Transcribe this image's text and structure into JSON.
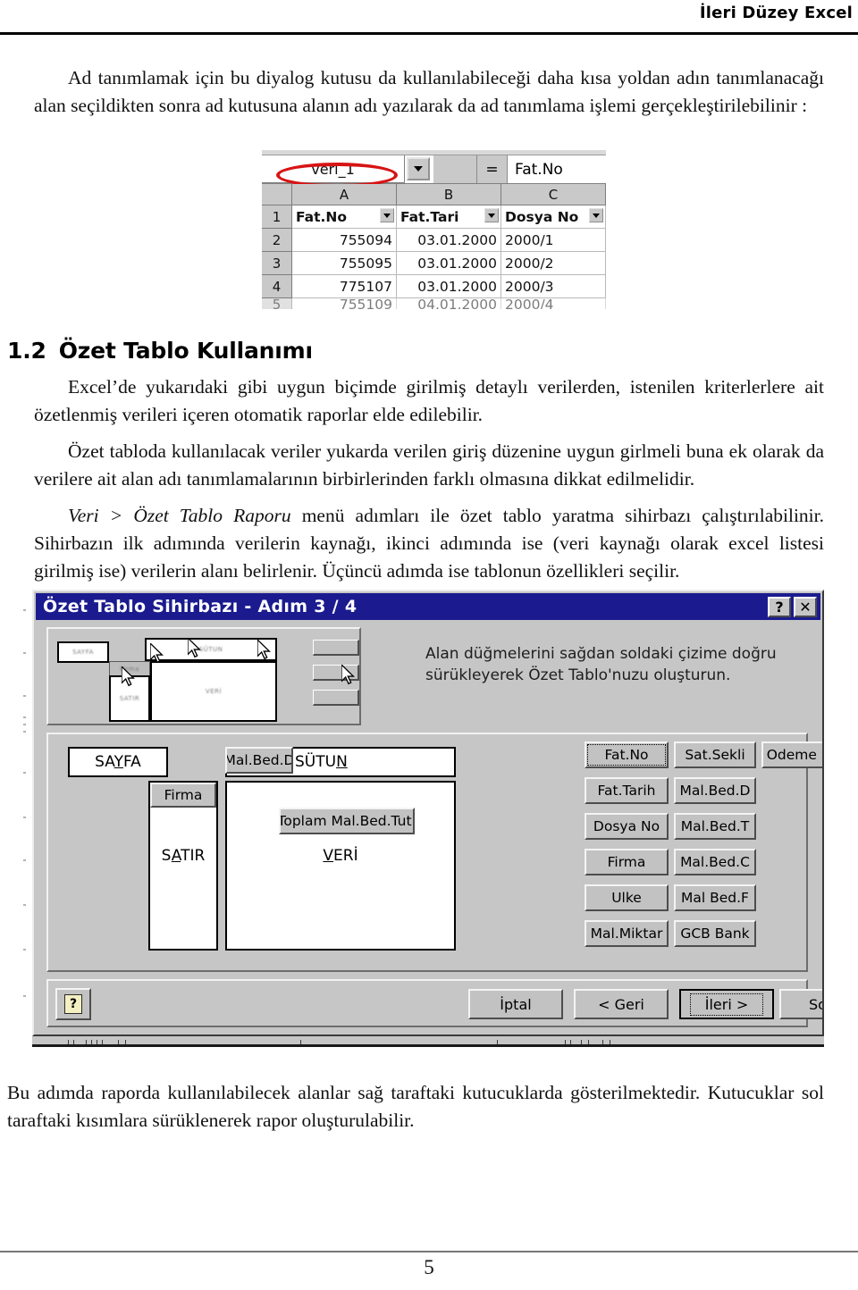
{
  "header": {
    "title": "İleri Düzey Excel"
  },
  "intro_paragraph": "Ad tanımlamak için bu diyalog kutusu da kullanılabileceği daha kısa yoldan adın tanımlanacağı alan seçildikten sonra ad kutusuna alanın adı yazılarak da ad tanımlama işlemi gerçekleştirilebilinir :",
  "excel_snippet": {
    "name_box_value": "veri_1",
    "equals_sign": "=",
    "formula_value": "Fat.No",
    "column_headers": [
      "A",
      "B",
      "C"
    ],
    "rows": [
      {
        "num": "1",
        "cells": [
          "Fat.No",
          "Fat.Tari",
          "Dosya No"
        ],
        "is_filter_header": true
      },
      {
        "num": "2",
        "cells": [
          "755094",
          "03.01.2000",
          "2000/1"
        ]
      },
      {
        "num": "3",
        "cells": [
          "755095",
          "03.01.2000",
          "2000/2"
        ]
      },
      {
        "num": "4",
        "cells": [
          "775107",
          "03.01.2000",
          "2000/3"
        ]
      },
      {
        "num": "5",
        "cells": [
          "755109",
          "04.01.2000",
          "2000/4"
        ]
      }
    ]
  },
  "section": {
    "number": "1.2",
    "title": "Özet Tablo Kullanımı",
    "paragraph_1": "Excel’de yukarıdaki gibi uygun biçimde girilmiş detaylı verilerden, istenilen kriterlerlere ait özetlenmiş verileri içeren otomatik raporlar elde edilebilir.",
    "paragraph_2": "Özet tabloda kullanılacak veriler yukarda verilen giriş düzenine uygun girlmeli buna ek olarak da verilere ait alan adı tanımlamalarının birbirlerinden farklı olmasına dikkat edilmelidir.",
    "paragraph_3_italic": "Veri > Özet Tablo Raporu",
    "paragraph_3_rest": " menü adımları ile özet tablo yaratma sihirbazı çalıştırılabilinir. Sihirbazın ilk adımında verilerin kaynağı, ikinci adımında ise (veri kaynağı olarak excel listesi girilmiş ise) verilerin alanı belirlenir. Üçüncü adımda ise tablonun özellikleri seçilir."
  },
  "dialog": {
    "title": "Özet Tablo Sihirbazı - Adım 3 / 4",
    "titlebar_buttons": [
      {
        "name": "help-titlebar-button",
        "glyph": "?"
      },
      {
        "name": "close-button",
        "glyph": "✕"
      }
    ],
    "instruction": "Alan düğmelerini sağdan soldaki çizime doğru sürükleyerek Özet Tablo'nuzu oluşturun.",
    "drop_zones": {
      "page": "SAYFA",
      "page_accel": "Y",
      "column": "SÜTUN",
      "column_accel": "N",
      "row": "SATIR",
      "row_accel": "A",
      "data": "VERİ",
      "data_accel": "V"
    },
    "placed_fields": {
      "column_field": "Mal.Bed.D",
      "row_field": "Firma",
      "data_field": "Toplam Mal.Bed.Tut."
    },
    "field_buttons": [
      "Fat.No",
      "Sat.Sekli",
      "Odeme Se",
      "Fat.Tarih",
      "Mal.Bed.D",
      "Dosya No",
      "Mal.Bed.T",
      "Firma",
      "Mal.Bed.C",
      "Ulke",
      "Mal Bed.F",
      "Mal.Miktar",
      "GCB Bank"
    ],
    "buttons": {
      "help": "?",
      "cancel": "İptal",
      "back": "< Geri",
      "next": "İleri >",
      "finish": "Son"
    }
  },
  "closing_paragraph": "Bu adımda raporda kullanılabilecek alanlar sağ taraftaki kutucuklarda gösterilmektedir. Kutucuklar sol taraftaki kısımlara sürüklenerek rapor oluşturulabilir.",
  "footer": {
    "page_number": "5"
  },
  "colors": {
    "titlebar": "#1b1b8f",
    "dialog_face": "#c6c6c6",
    "annotation_red": "#d71414"
  }
}
